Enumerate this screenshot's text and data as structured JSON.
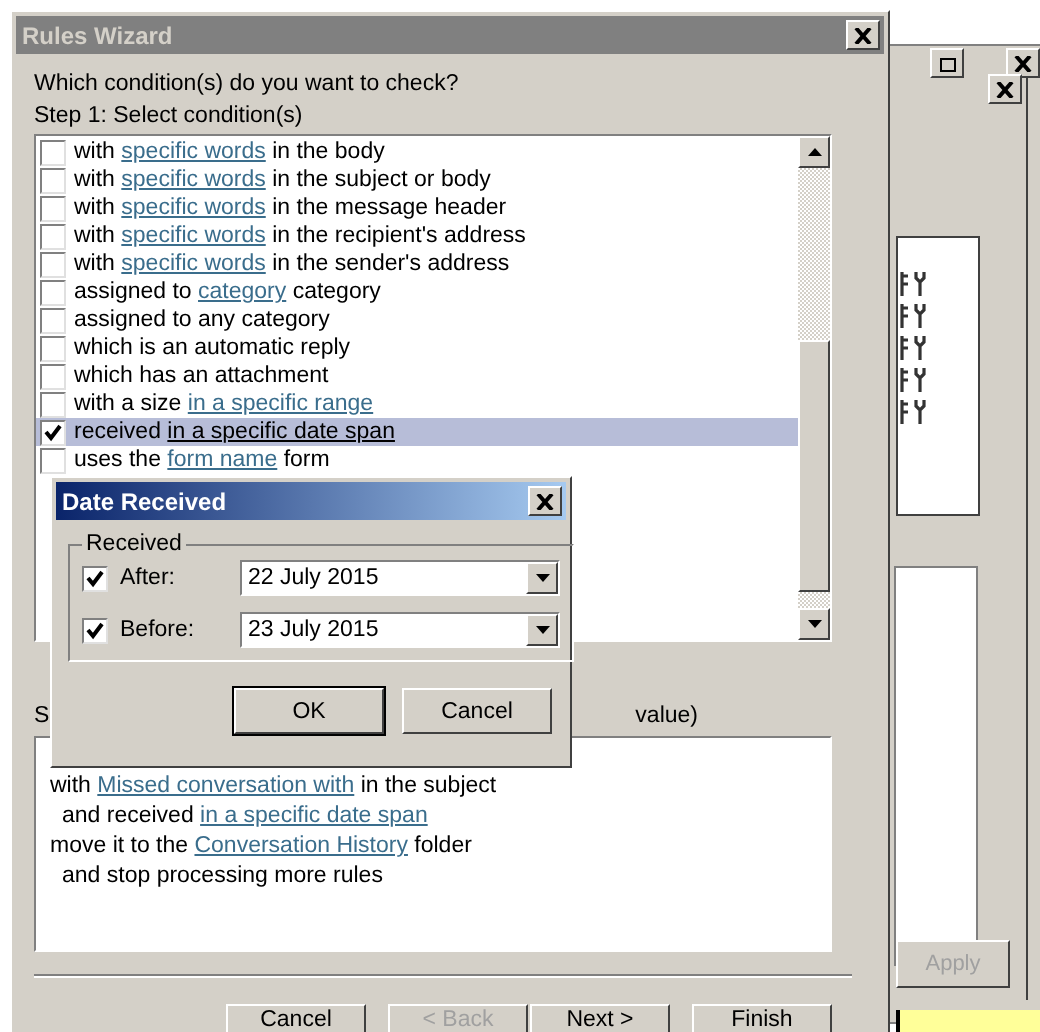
{
  "background_window": {
    "apply_button": {
      "label": "Apply",
      "disabled": true
    }
  },
  "wizard": {
    "title": "Rules Wizard",
    "heading": "Which condition(s) do you want to check?",
    "step1_label": "Step 1: Select condition(s)",
    "conditions": [
      {
        "before": "with ",
        "link": "specific words",
        "after": " in the body",
        "checked": false,
        "selected": false
      },
      {
        "before": "with ",
        "link": "specific words",
        "after": " in the subject or body",
        "checked": false,
        "selected": false
      },
      {
        "before": "with ",
        "link": "specific words",
        "after": " in the message header",
        "checked": false,
        "selected": false
      },
      {
        "before": "with ",
        "link": "specific words",
        "after": " in the recipient's address",
        "checked": false,
        "selected": false
      },
      {
        "before": "with ",
        "link": "specific words",
        "after": " in the sender's address",
        "checked": false,
        "selected": false
      },
      {
        "before": "assigned to ",
        "link": "category",
        "after": " category",
        "checked": false,
        "selected": false
      },
      {
        "before": "assigned to any category",
        "checked": false,
        "selected": false
      },
      {
        "before": "which is an automatic reply",
        "checked": false,
        "selected": false
      },
      {
        "before": "which has an attachment",
        "checked": false,
        "selected": false
      },
      {
        "before": "with a size ",
        "link": "in a specific range",
        "checked": false,
        "selected": false
      },
      {
        "before": "received ",
        "link": "in a specific date span",
        "checked": true,
        "selected": true
      },
      {
        "before": "uses the ",
        "link": "form name",
        "after": " form",
        "checked": false,
        "selected": false
      }
    ],
    "step2_label_parts": [
      "S",
      "value)"
    ],
    "description": [
      {
        "before": "with ",
        "link": "Missed conversation with",
        "after": " in the subject",
        "indented": false
      },
      {
        "before": "and received ",
        "link": "in a specific date span",
        "indented": true
      },
      {
        "before": "move it to the ",
        "link": "Conversation History",
        "after": " folder",
        "indented": false
      },
      {
        "before": "and stop processing more rules",
        "indented": true
      }
    ],
    "buttons": [
      {
        "label": "Cancel",
        "disabled": false
      },
      {
        "label": "< Back",
        "disabled": true
      },
      {
        "label": "Next >",
        "disabled": false
      },
      {
        "label": "Finish",
        "disabled": false
      }
    ]
  },
  "date_dialog": {
    "title": "Date Received",
    "group_label": "Received",
    "rows": [
      {
        "label": "After:",
        "checked": true,
        "value": "22 July 2015"
      },
      {
        "label": "Before:",
        "checked": true,
        "value": "23 July 2015"
      }
    ],
    "buttons": [
      {
        "label": "OK",
        "default": true
      },
      {
        "label": "Cancel",
        "default": false
      }
    ]
  }
}
